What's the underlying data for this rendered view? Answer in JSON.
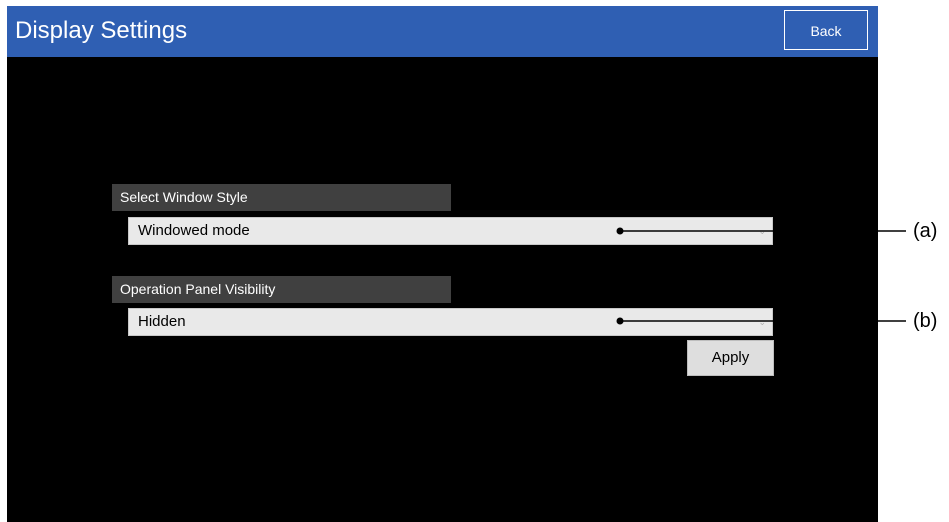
{
  "window": {
    "title": "Display Settings",
    "back_label": "Back"
  },
  "settings": {
    "window_style": {
      "label": "Select Window Style",
      "value": "Windowed mode"
    },
    "panel_visibility": {
      "label": "Operation Panel Visibility",
      "value": "Hidden"
    },
    "apply_label": "Apply"
  },
  "callouts": {
    "a": "(a)",
    "b": "(b)"
  },
  "colors": {
    "titlebar": "#2f5fb3",
    "background": "#000000",
    "label_bg": "#404040",
    "field_bg": "#e9e9e9"
  }
}
